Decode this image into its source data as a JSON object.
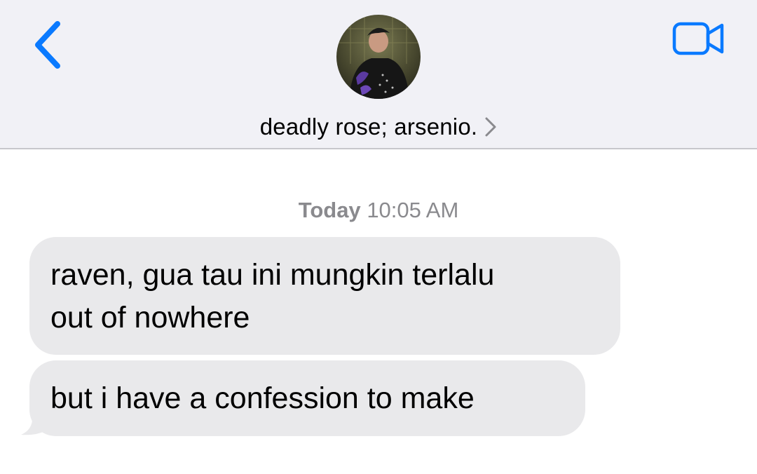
{
  "header": {
    "back_icon": "chevron-left-icon",
    "video_icon": "video-camera-icon",
    "avatar_icon": "contact-avatar",
    "contact_name": "deadly rose; arsenio.",
    "contact_chevron": "›",
    "accent_color": "#0a7aff"
  },
  "conversation": {
    "timestamp_day": "Today",
    "timestamp_time": "10:05 AM",
    "messages": [
      {
        "direction": "incoming",
        "text": "raven, gua tau ini mungkin terlalu\nout of nowhere"
      },
      {
        "direction": "incoming",
        "text": "but i have a confession to make"
      }
    ],
    "bubble_color": "#e9e9eb"
  }
}
